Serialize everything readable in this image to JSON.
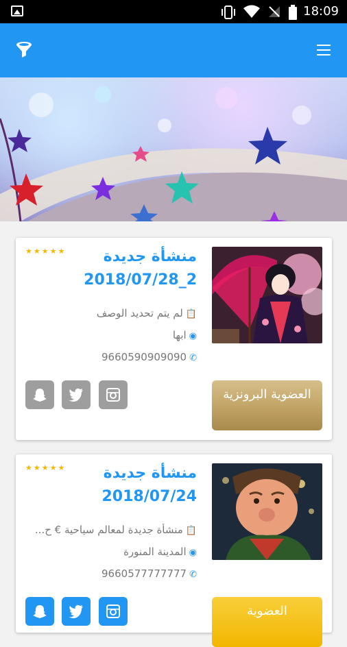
{
  "status_bar": {
    "time": "18:09"
  },
  "app_bar": {
    "filter_icon": "filter-icon",
    "menu_icon": "menu-icon"
  },
  "banner": {
    "image": "stars-book-banner"
  },
  "listings": [
    {
      "title_line1": "منشأة جديدة",
      "title_line2": "2_2018/07/28",
      "description": "لم يتم تحديد الوصف",
      "city": "ابها",
      "phone": "9660590909090",
      "membership": "العضوية البرونزية",
      "rating_stars": "★★★★★",
      "social_style": "grey"
    },
    {
      "title_line1": "منشأة جديدة",
      "title_line2": "2018/07/24",
      "description": "منشأة جديدة لمعالم سياحية € ح...",
      "city": "المدينة المنورة",
      "phone": "9660577777777",
      "membership": "العضوية",
      "rating_stars": "★★★★★",
      "social_style": "blue"
    }
  ],
  "colors": {
    "primary": "#2196f3",
    "bronze": "#c2a469",
    "gold": "#f5c21f"
  }
}
